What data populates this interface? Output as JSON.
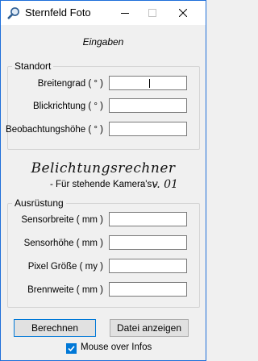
{
  "window": {
    "title": "Sternfeld Foto",
    "icon": "search-icon",
    "controls": {
      "minimize": "minimize-icon",
      "maximize": "maximize-icon",
      "close": "close-icon"
    }
  },
  "header": {
    "label": "Eingaben"
  },
  "standort": {
    "title": "Standort",
    "fields": [
      {
        "label": "Breitengrad ( ° )",
        "value": "",
        "focused": true
      },
      {
        "label": "Blickrichtung ( ° )",
        "value": ""
      },
      {
        "label": "Beobachtungshöhe ( ° )",
        "value": ""
      }
    ]
  },
  "branding": {
    "title": "Belichtungsrechner",
    "subtitle": "- Für stehende Kamera's -",
    "version": "v. 01"
  },
  "ausruestung": {
    "title": "Ausrüstung",
    "fields": [
      {
        "label": "Sensorbreite ( mm )",
        "value": ""
      },
      {
        "label": "Sensorhöhe ( mm )",
        "value": ""
      },
      {
        "label": "Pixel Größe ( my )",
        "value": ""
      },
      {
        "label": "Brennweite ( mm )",
        "value": ""
      }
    ]
  },
  "buttons": {
    "calculate": "Berechnen",
    "show_file": "Datei anzeigen"
  },
  "mouseover": {
    "label": "Mouse over Infos",
    "checked": true
  },
  "colors": {
    "accent": "#0078d7",
    "window_border": "#1e6fd9",
    "background": "#f0f0f0"
  }
}
